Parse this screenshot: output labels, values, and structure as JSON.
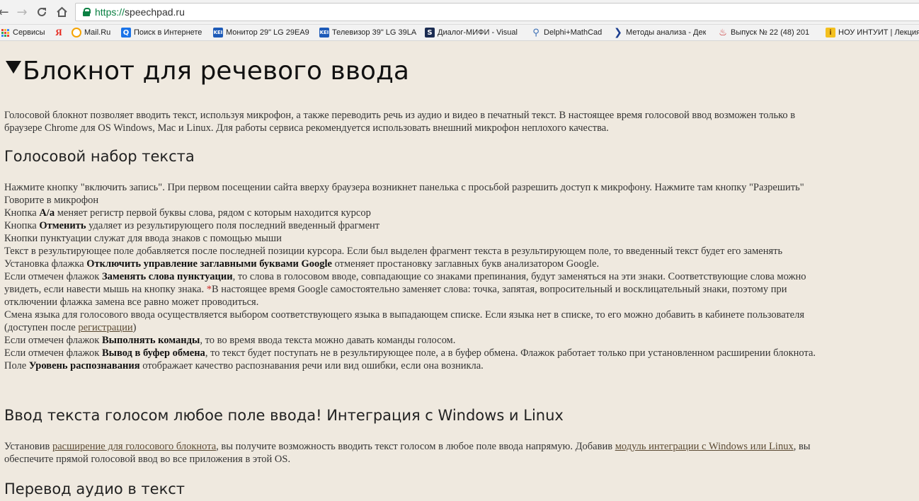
{
  "browser": {
    "url_scheme": "https://",
    "url_host": "speechpad.ru",
    "bookmarks": [
      {
        "label": "Сервисы",
        "icon": "apps-grid-icon"
      },
      {
        "label": "",
        "icon": "yandex-icon"
      },
      {
        "label": "Mail.Ru",
        "icon": "mailru-icon"
      },
      {
        "label": "Поиск в Интернете",
        "icon": "search-icon"
      },
      {
        "label": "Монитор 29\" LG 29EA9",
        "icon": "kei-icon"
      },
      {
        "label": "Телевизор 39\" LG 39LA",
        "icon": "kei-icon"
      },
      {
        "label": "Диалог-МИФИ - Visual",
        "icon": "dialog-mifi-icon"
      },
      {
        "label": "Delphi+MathCad",
        "icon": "search-glass-icon"
      },
      {
        "label": "Методы анализа - Дек",
        "icon": "arrow-icon"
      },
      {
        "label": "Выпуск № 22 (48) 201",
        "icon": "issue-icon"
      },
      {
        "label": "НОУ ИНТУИТ | Лекция",
        "icon": "intuit-icon"
      }
    ]
  },
  "page": {
    "title": "Блокнот для речевого ввода",
    "intro": [
      "Голосовой блокнот позволяет вводить текст, используя микрофон, а также переводить речь из аудио и видео в печатный текст. В настоящее время голосовой ввод возможен только в",
      "браузере Chrome для OS Windows, Mac и Linux. Для работы сервиса рекомендуется использовать внешний микрофон неплохого качества."
    ],
    "section1": {
      "heading": "Голосовой набор текста",
      "l1": "Нажмите кнопку \"включить запись\". При первом посещении сайта вверху браузера возникнет панелька с просьбой разрешить доступ к микрофону. Нажмите там кнопку \"Разрешить\"",
      "l2": "Говорите в микрофон",
      "l3_pre": "Кнопка ",
      "l3_bold": "A/a",
      "l3_post": " меняет регистр первой буквы слова, рядом с которым находится курсор",
      "l4_pre": "Кнопка ",
      "l4_bold": "Отменить",
      "l4_post": " удаляет из результирующего поля последний введенный фрагмент",
      "l5": "Кнопки пунктуации служат для ввода знаков с помощью мыши",
      "l6": "Текст в результирующее поле добавляется после последней позиции курсора. Если был выделен фрагмент текста в результирующем поле, то введенный текст будет его заменять",
      "l7_pre": "Установка флажка ",
      "l7_bold": "Отключить управление заглавными буквами Google",
      "l7_post": " отменяет простановку заглавных букв анализатором Google.",
      "l8_pre": "Если отмечен флажок ",
      "l8_bold": "Заменять слова пунктуации",
      "l8_post": ", то слова в голосовом вводе, совпадающие со знаками препинания, будут заменяться на эти знаки. Соответствующие слова можно",
      "l9_pre": "увидеть, если навести мышь на кнопку знака. ",
      "l9_star": "*",
      "l9_post": "В настоящее время Google самостоятельно заменяет слова: точка, запятая, вопросительный и восклицательный знаки, поэтому при",
      "l10": "отключении флажка замена все равно может проводиться.",
      "l11": "Смена языка для голосового ввода осуществляется выбором соответствующего языка в выпадающем списке. Если языка нет в списке, то его можно добавить в кабинете пользователя",
      "l12_pre": "(доступен после ",
      "l12_link": "регистрации",
      "l12_post": ")",
      "l13_pre": "Если отмечен флажок ",
      "l13_bold": "Выполнять команды",
      "l13_post": ", то во время ввода текста можно давать команды голосом.",
      "l14_pre": "Если отмечен флажок ",
      "l14_bold": "Вывод в буфер обмена",
      "l14_post": ", то текст будет поступать не в результирующее поле, а в буфер обмена. Флажок работает только при установленном расширении блокнота.",
      "l15_pre": "Поле ",
      "l15_bold": "Уровень распознавания",
      "l15_post": " отображает качество распознавания речи или вид ошибки, если она возникла."
    },
    "section2": {
      "heading": "Ввод текста голосом любое поле ввода! Интеграция с Windows и Linux",
      "l1_pre": "Установив ",
      "l1_link1": "расширение для голосового блокнота",
      "l1_mid": ", вы получите возможность вводить текст голосом в любое поле ввода напрямую. Добавив ",
      "l1_link2": "модуль интеграции с Windows или Linux",
      "l1_post": ", вы",
      "l2": "обеспечите прямой голосовой ввод во все приложения в этой OS."
    },
    "section3": {
      "heading": "Перевод аудио в текст"
    }
  }
}
